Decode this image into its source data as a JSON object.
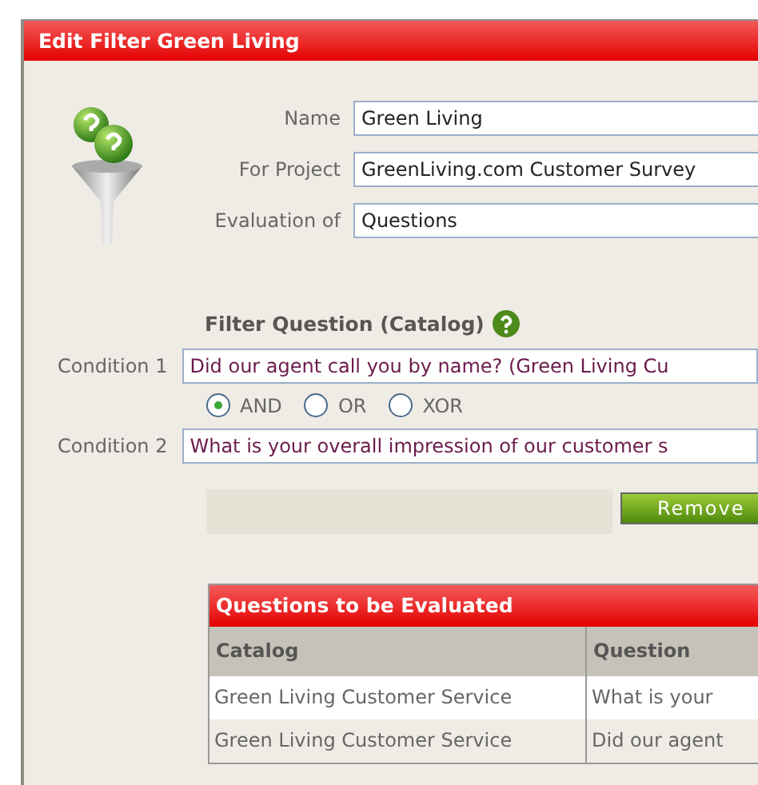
{
  "window": {
    "title": "Edit Filter Green Living"
  },
  "fields": [
    {
      "label": "Name",
      "value": "Green Living"
    },
    {
      "label": "For Project",
      "value": "GreenLiving.com Customer Survey"
    },
    {
      "label": "Evaluation of",
      "value": "Questions"
    }
  ],
  "filter": {
    "title": "Filter Question (Catalog)",
    "conditions": [
      {
        "label": "Condition 1",
        "value": "Did our agent call you by name? (Green Living Cu"
      },
      {
        "label": "Condition 2",
        "value": "What is your overall impression of our customer s"
      }
    ],
    "operators": [
      {
        "label": "AND",
        "selected": true
      },
      {
        "label": "OR",
        "selected": false
      },
      {
        "label": "XOR",
        "selected": false
      }
    ],
    "button": "Remove"
  },
  "table": {
    "title": "Questions to be Evaluated",
    "columns": [
      "Catalog",
      "Question"
    ],
    "rows": [
      [
        "Green Living Customer Service",
        "What is your"
      ],
      [
        "Green Living Customer Service",
        "Did our agent"
      ]
    ]
  }
}
